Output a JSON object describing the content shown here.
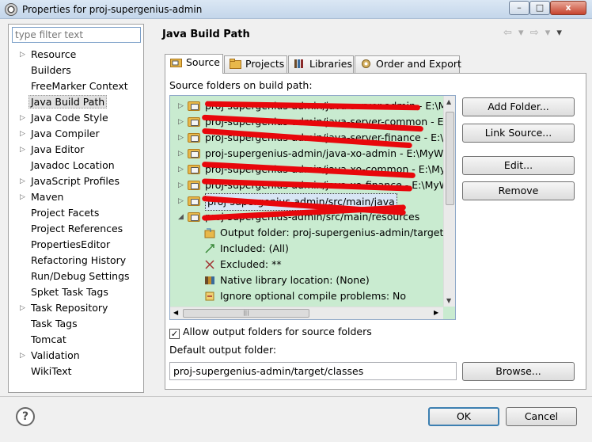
{
  "window": {
    "title": "Properties for proj-supergenius-admin",
    "minimize": "–",
    "maximize": "□",
    "close": "x"
  },
  "filter": {
    "placeholder": "type filter text"
  },
  "nav": [
    {
      "label": "Resource",
      "expandable": true
    },
    {
      "label": "Builders",
      "expandable": false
    },
    {
      "label": "FreeMarker Context",
      "expandable": false
    },
    {
      "label": "Java Build Path",
      "expandable": false,
      "selected": true
    },
    {
      "label": "Java Code Style",
      "expandable": true
    },
    {
      "label": "Java Compiler",
      "expandable": true
    },
    {
      "label": "Java Editor",
      "expandable": true
    },
    {
      "label": "Javadoc Location",
      "expandable": false
    },
    {
      "label": "JavaScript Profiles",
      "expandable": true
    },
    {
      "label": "Maven",
      "expandable": true
    },
    {
      "label": "Project Facets",
      "expandable": false
    },
    {
      "label": "Project References",
      "expandable": false
    },
    {
      "label": "PropertiesEditor",
      "expandable": false
    },
    {
      "label": "Refactoring History",
      "expandable": false
    },
    {
      "label": "Run/Debug Settings",
      "expandable": false
    },
    {
      "label": "Spket Task Tags",
      "expandable": false
    },
    {
      "label": "Task Repository",
      "expandable": true
    },
    {
      "label": "Task Tags",
      "expandable": false
    },
    {
      "label": "Tomcat",
      "expandable": false
    },
    {
      "label": "Validation",
      "expandable": true
    },
    {
      "label": "WikiText",
      "expandable": false
    }
  ],
  "page": {
    "title": "Java Build Path",
    "back_icon": "⇦ ▾",
    "forward_icon": "⇨ ▾",
    "menu_icon": "▾"
  },
  "tabs": [
    "Source",
    "Projects",
    "Libraries",
    "Order and Export"
  ],
  "source": {
    "label": "Source folders on build path:",
    "tree": [
      {
        "text": "proj-supergenius-admin/java-server-admin - E:\\MyWo",
        "type": "folder",
        "expanded": false
      },
      {
        "text": "proj-supergenius-admin/java-server-common - E:\\My",
        "type": "folder",
        "expanded": false
      },
      {
        "text": "proj-supergenius-admin/java-server-finance - E:\\My",
        "type": "folder",
        "expanded": false
      },
      {
        "text": "proj-supergenius-admin/java-xo-admin - E:\\MyWor",
        "type": "folder",
        "expanded": false
      },
      {
        "text": "proj-supergenius-admin/java-xo-common - E:\\MyWor",
        "type": "folder",
        "expanded": false
      },
      {
        "text": "proj-supergenius-admin/java-xo-finance - E:\\MyWo",
        "type": "folder",
        "expanded": false
      },
      {
        "text": "proj-supergenius-admin/src/main/java",
        "type": "folder",
        "expanded": false,
        "selected": true
      },
      {
        "text": "proj-supergenius-admin/src/main/resources",
        "type": "folder",
        "expanded": true
      },
      {
        "text": "Output folder: proj-supergenius-admin/target/cl",
        "type": "child",
        "icon": "output-folder-icon"
      },
      {
        "text": "Included: (All)",
        "type": "child",
        "icon": "included-icon"
      },
      {
        "text": "Excluded: **",
        "type": "child",
        "icon": "excluded-icon"
      },
      {
        "text": "Native library location: (None)",
        "type": "child",
        "icon": "native-library-icon"
      },
      {
        "text": "Ignore optional compile problems: No",
        "type": "child",
        "icon": "ignore-problems-icon"
      }
    ],
    "hscroll_grip": "|||",
    "buttons": {
      "add_folder": "Add Folder...",
      "link_source": "Link Source...",
      "edit": "Edit...",
      "remove": "Remove",
      "browse": "Browse..."
    },
    "allow_output": {
      "label": "Allow output folders for source folders",
      "checked": true,
      "check_glyph": "✓"
    },
    "default_output_label": "Default output folder:",
    "default_output_value": "proj-supergenius-admin/target/classes"
  },
  "footer": {
    "ok": "OK",
    "cancel": "Cancel",
    "help": "?"
  }
}
